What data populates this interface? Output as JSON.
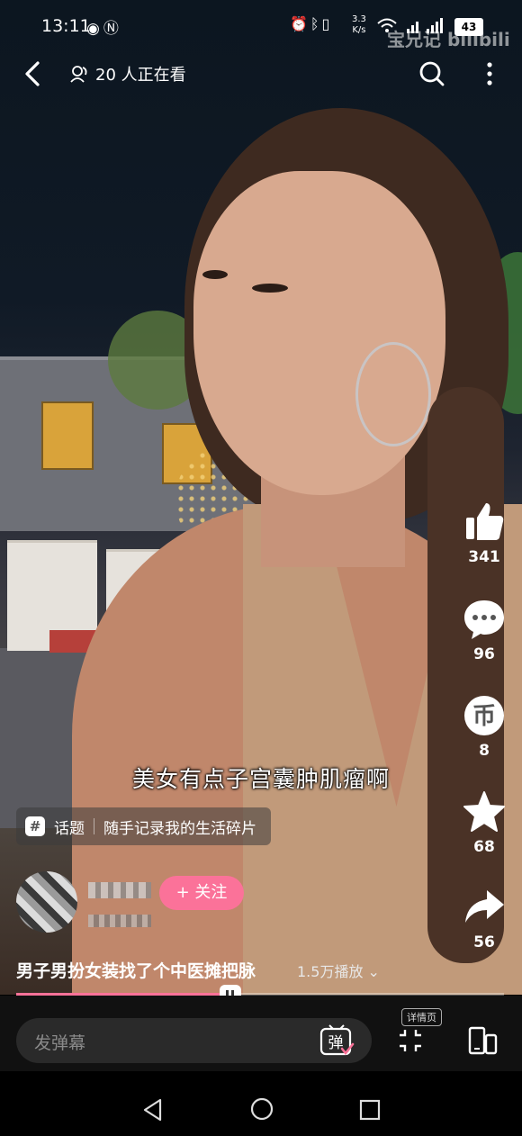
{
  "status_bar": {
    "time": "13:11",
    "left_icons": [
      "eye-icon",
      "nfc-icon"
    ],
    "right_icons": [
      "alarm-icon",
      "bluetooth-icon",
      "vibrate-icon"
    ],
    "net_speed_value": "3.3",
    "net_speed_unit": "K/s",
    "battery": "43",
    "watermark": "宝兄记 bilibili"
  },
  "top_nav": {
    "viewers_text": "20 人正在看"
  },
  "subtitle": "美女有点子宫囊肿肌瘤啊",
  "topic": {
    "badge": "#",
    "label": "话题",
    "name": "随手记录我的生活碎片"
  },
  "author": {
    "follow_label": "+ 关注"
  },
  "actions": {
    "likes": "341",
    "comments": "96",
    "coins": "8",
    "favorites": "68",
    "shares": "56"
  },
  "video": {
    "title": "男子男扮女装找了个中医摊把脉",
    "plays": "1.5万播放",
    "progress": 0.44
  },
  "bottom_bar": {
    "danmu_placeholder": "发弹幕",
    "danmu_button": "弹",
    "detail_tag": "详情页"
  },
  "colors": {
    "accent": "#fb7299"
  }
}
